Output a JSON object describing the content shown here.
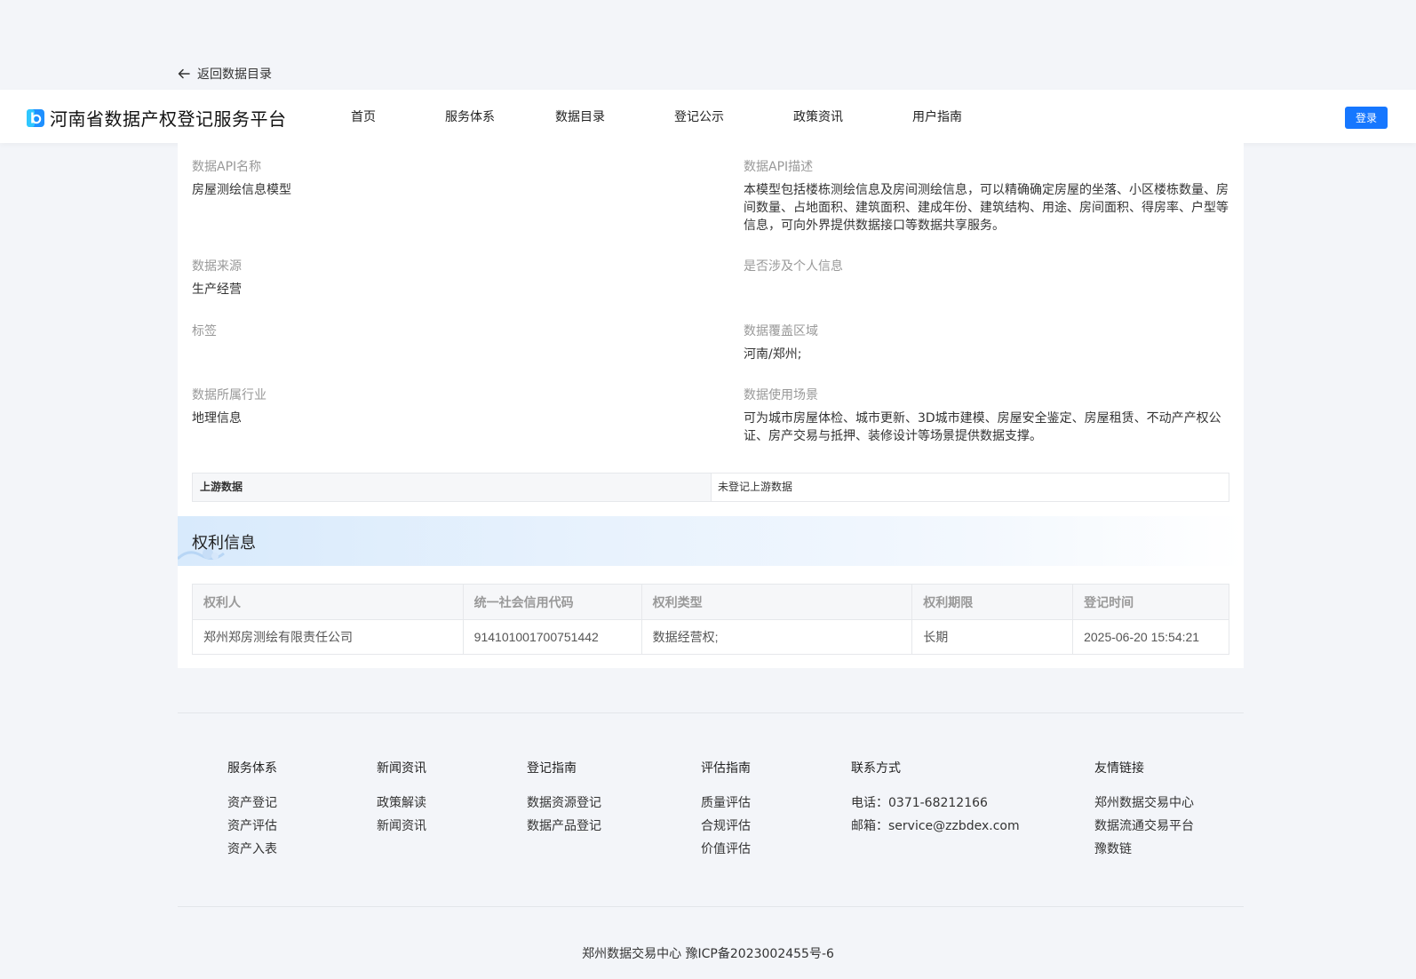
{
  "back_link": {
    "label": "返回数据目录"
  },
  "header": {
    "title": "河南省数据产权登记服务平台",
    "nav": [
      "首页",
      "服务体系",
      "数据目录",
      "登记公示",
      "政策资讯",
      "用户指南"
    ],
    "login_label": "登录",
    "accent": "#1677ff"
  },
  "details": {
    "api_name_label": "数据API名称",
    "api_name": "房屋测绘信息模型",
    "api_desc_label": "数据API描述",
    "api_desc": "本模型包括楼栋测绘信息及房间测绘信息，可以精确确定房屋的坐落、小区楼栋数量、房间数量、占地面积、建筑面积、建成年份、建筑结构、用途、房间面积、得房率、户型等信息，可向外界提供数据接口等数据共享服务。",
    "source_label": "数据来源",
    "source": "生产经营",
    "personal_label": "是否涉及个人信息",
    "personal": "",
    "tag_label": "标签",
    "tag": "",
    "region_label": "数据覆盖区域",
    "region": "河南/郑州;",
    "industry_label": "数据所属行业",
    "industry": "地理信息",
    "scene_label": "数据使用场景",
    "scene": "可为城市房屋体检、城市更新、3D城市建模、房屋安全鉴定、房屋租赁、不动产产权公证、房产交易与抵押、装修设计等场景提供数据支撑。"
  },
  "upstream": {
    "label": "上游数据",
    "value": "未登记上游数据"
  },
  "rights": {
    "title": "权利信息",
    "columns": [
      "权利人",
      "统一社会信用代码",
      "权利类型",
      "权利期限",
      "登记时间"
    ],
    "rows": [
      [
        "郑州郑房测绘有限责任公司",
        "914101001700751442",
        "数据经营权;",
        "长期",
        "2025-06-20 15:54:21"
      ]
    ]
  },
  "footer": {
    "columns": [
      {
        "title": "服务体系",
        "items": [
          "资产登记",
          "资产评估",
          "资产入表"
        ]
      },
      {
        "title": "新闻资讯",
        "items": [
          "政策解读",
          "新闻资讯"
        ]
      },
      {
        "title": "登记指南",
        "items": [
          "数据资源登记",
          "数据产品登记"
        ]
      },
      {
        "title": "评估指南",
        "items": [
          "质量评估",
          "合规评估",
          "价值评估"
        ]
      },
      {
        "title": "联系方式",
        "items": [
          "电话：0371-68212166",
          "邮箱：service@zzbdex.com"
        ]
      },
      {
        "title": "友情链接",
        "items": [
          "郑州数据交易中心",
          "数据流通交易平台",
          "豫数链"
        ]
      }
    ],
    "copyright": "郑州数据交易中心   豫ICP备2023002455号-6"
  }
}
